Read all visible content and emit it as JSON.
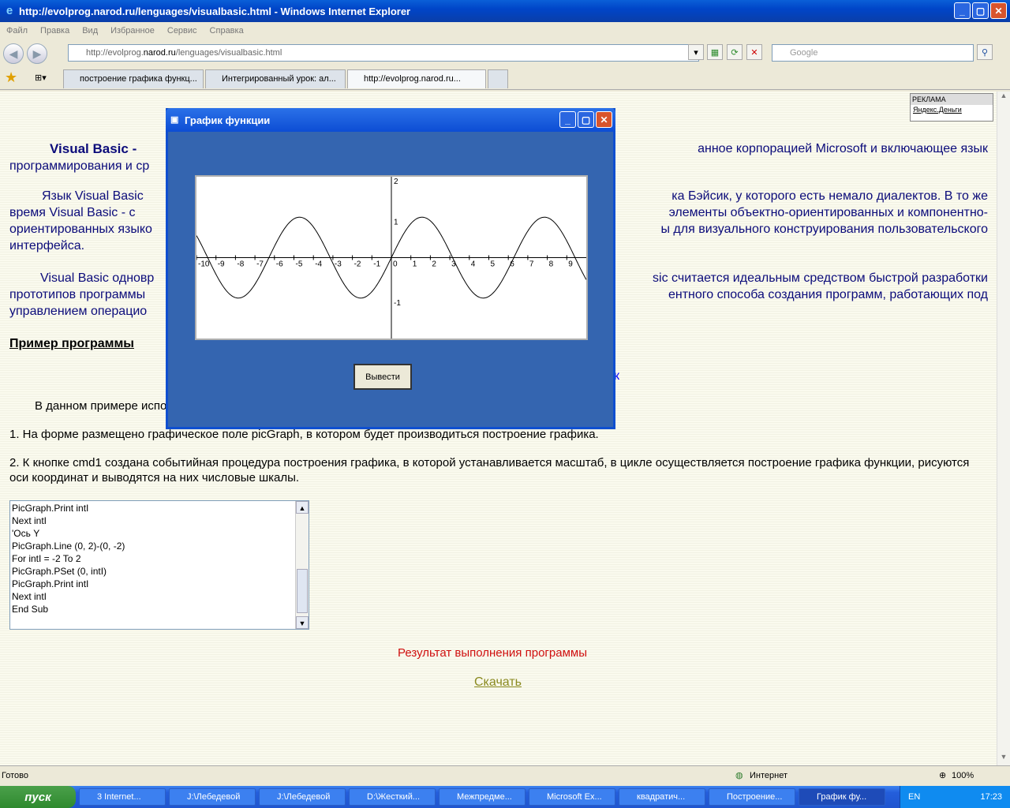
{
  "window": {
    "title": "http://evolprog.narod.ru/lenguages/visualbasic.html - Windows Internet Explorer"
  },
  "menu": [
    "Файл",
    "Правка",
    "Вид",
    "Избранное",
    "Сервис",
    "Справка"
  ],
  "address": {
    "prefix": "http://evolprog.",
    "host": "narod.ru",
    "path": "/lenguages/visualbasic.html"
  },
  "search": {
    "placeholder": "Google"
  },
  "tabs": [
    "построение графика функц...",
    "Интегрированный урок: ал...",
    "http://evolprog.narod.ru..."
  ],
  "ad": {
    "label": "РЕКЛАМА",
    "link": "Яндекс.Деньги"
  },
  "page": {
    "p1a": "Visual Basic -",
    "p1b": "анное корпорацией Microsoft и включающее язык",
    "p1c": "программирования и ср",
    "p2a": "Язык Visual Basic",
    "p2b": "ка Бэйсик, у которого есть немало диалектов. В то же",
    "p2c": "время Visual Basic - с",
    "p2d": "элементы объектно-ориентированных и компонентно-",
    "p2e": "ориентированных языко",
    "p2f": "ы для визуального конструирования пользовательского",
    "p2g": "интерфейса.",
    "p3a": "Visual Basic одновр",
    "p3b": "sic считается идеальным средством быстрой разработки",
    "p3c": "прототипов программы",
    "p3d": "ентного способа создания программ, работающих под",
    "p3e": "управлением операцио",
    "heading": "Пример программы",
    "stray": "к",
    "intro": "В данном примере испо",
    "item1": "1.     На форме размещено графическое поле picGraph, в котором будет производиться построение графика.",
    "item2": "2.     К кнопке cmd1 создана событийная процедура построения графика, в которой устанавливается масштаб, в цикле осуществляется построение графика функции, рисуются оси координат и выводятся на них числовые шкалы.",
    "result": "Результат выполнения программы",
    "download": "Скачать"
  },
  "code": [
    "PicGraph.Print intI",
    "Next intI",
    "'Ось Y",
    "PicGraph.Line (0, 2)-(0, -2)",
    "For intI = -2 To 2",
    "PicGraph.PSet (0, intI)",
    "PicGraph.Print intI",
    "Next intI",
    "End Sub"
  ],
  "dialog": {
    "title": "График функции",
    "button": "Вывести"
  },
  "chart_data": {
    "type": "line",
    "function": "sin",
    "xlim": [
      -10,
      10
    ],
    "ylim": [
      -2,
      2
    ],
    "x_ticks": [
      -10,
      -9,
      -8,
      -7,
      -6,
      -5,
      -4,
      -3,
      -2,
      -1,
      0,
      1,
      2,
      3,
      4,
      5,
      6,
      7,
      8,
      9
    ],
    "y_ticks": [
      2,
      1,
      -1
    ],
    "samples_x": [
      -10,
      -9,
      -8,
      -7,
      -6,
      -5,
      -4,
      -3,
      -2,
      -1,
      0,
      1,
      2,
      3,
      4,
      5,
      6,
      7,
      8,
      9,
      10
    ],
    "samples_y": [
      0.54,
      -0.41,
      -0.99,
      -0.66,
      0.28,
      0.96,
      0.76,
      -0.14,
      -0.91,
      -0.84,
      0,
      0.84,
      0.91,
      0.14,
      -0.76,
      -0.96,
      -0.28,
      0.66,
      0.99,
      0.41,
      -0.54
    ]
  },
  "status": {
    "text": "Готово",
    "zone": "Интернет",
    "zoom": "100%"
  },
  "taskbar": {
    "start": "пуск",
    "items": [
      "3 Internet...",
      "J:\\Лебедевой",
      "J:\\Лебедевой",
      "D:\\Жесткий...",
      "Межпредме...",
      "Microsoft Ex...",
      "квадратич...",
      "Построение...",
      "График фу..."
    ],
    "lang": "EN",
    "time": "17:23"
  }
}
